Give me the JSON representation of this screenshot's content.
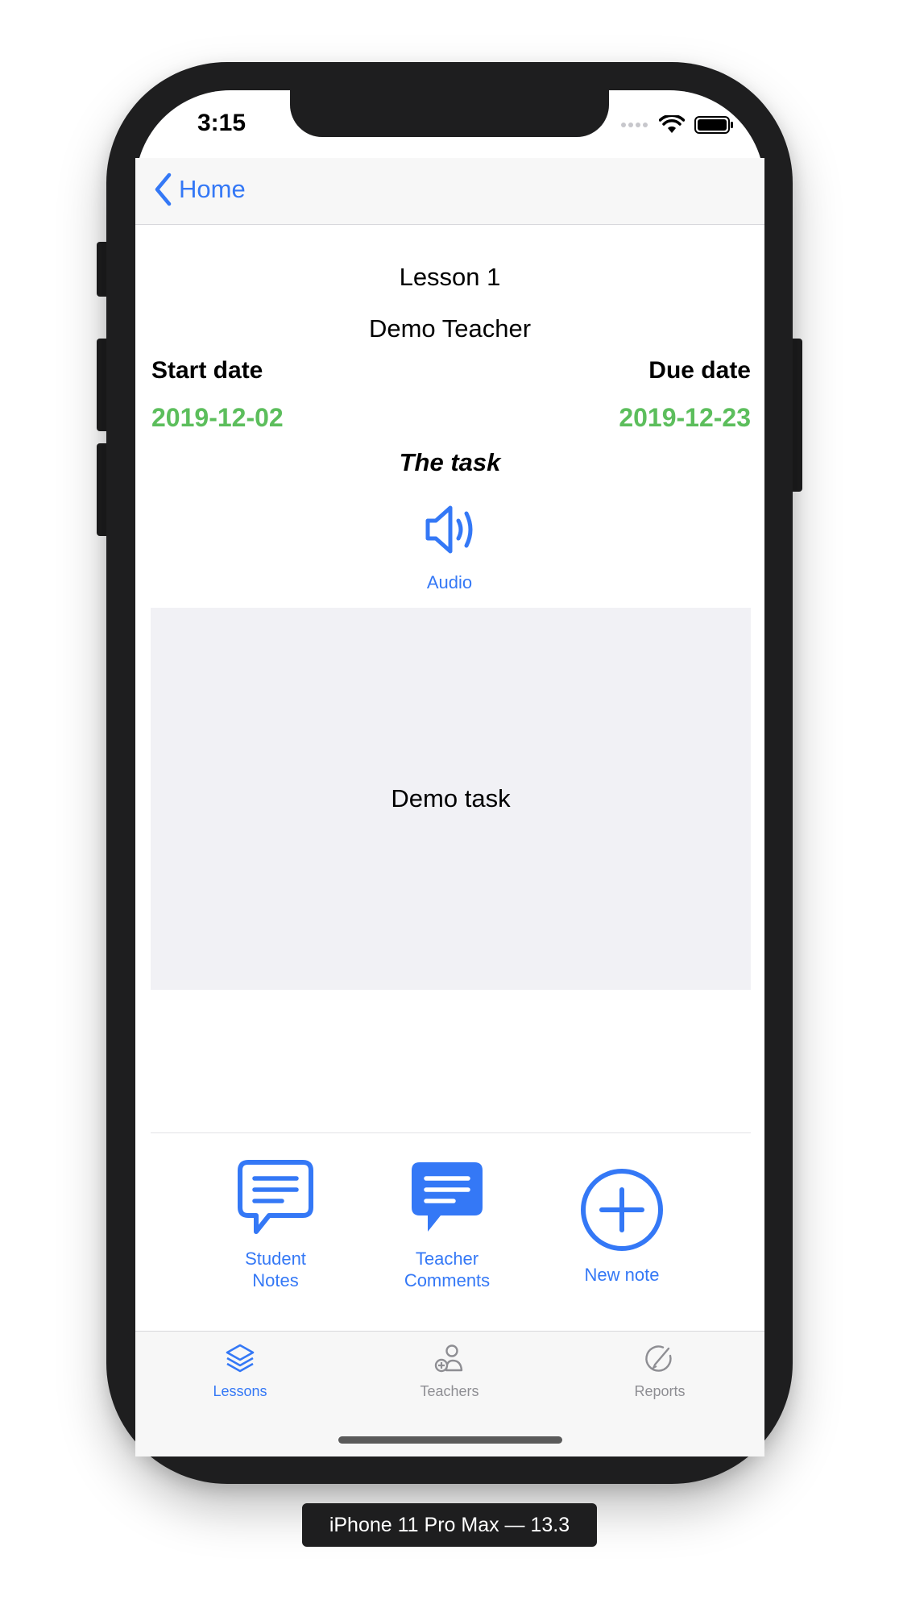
{
  "status_bar": {
    "time": "3:15"
  },
  "nav": {
    "back_label": "Home"
  },
  "lesson": {
    "title": "Lesson 1",
    "teacher": "Demo Teacher",
    "start_date_label": "Start date",
    "start_date": "2019-12-02",
    "due_date_label": "Due date",
    "due_date": "2019-12-23",
    "task_heading": "The task",
    "audio_label": "Audio",
    "task_text": "Demo task"
  },
  "actions": {
    "student_notes": "Student\nNotes",
    "teacher_comments": "Teacher\nComments",
    "new_note": "New note"
  },
  "tabbar": {
    "lessons": "Lessons",
    "teachers": "Teachers",
    "reports": "Reports",
    "selected": "lessons"
  },
  "device_caption": "iPhone 11 Pro Max — 13.3",
  "colors": {
    "accent": "#3478f6",
    "date_green": "#5cbe5c",
    "inactive": "#8e8e93",
    "task_box_bg": "#f1f1f5"
  }
}
